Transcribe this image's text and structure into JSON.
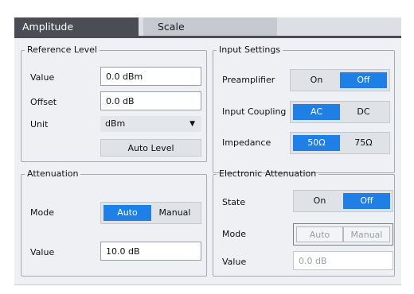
{
  "tabs": [
    {
      "label": "Amplitude",
      "active": true
    },
    {
      "label": "Scale",
      "active": false
    }
  ],
  "reference_level": {
    "legend": "Reference Level",
    "value_label": "Value",
    "value": "0.0 dBm",
    "offset_label": "Offset",
    "offset": "0.0 dB",
    "unit_label": "Unit",
    "unit": "dBm",
    "auto_level": "Auto Level"
  },
  "attenuation": {
    "legend": "Attenuation",
    "mode_label": "Mode",
    "mode_options": [
      "Auto",
      "Manual"
    ],
    "mode_selected": "Auto",
    "value_label": "Value",
    "value": "10.0 dB"
  },
  "input_settings": {
    "legend": "Input Settings",
    "preamplifier_label": "Preamplifier",
    "preamplifier_options": [
      "On",
      "Off"
    ],
    "preamplifier_selected": "Off",
    "coupling_label": "Input Coupling",
    "coupling_options": [
      "AC",
      "DC"
    ],
    "coupling_selected": "AC",
    "impedance_label": "Impedance",
    "impedance_options": [
      "50Ω",
      "75Ω"
    ],
    "impedance_selected": "50Ω"
  },
  "electronic_attenuation": {
    "legend": "Electronic Attenuation",
    "state_label": "State",
    "state_options": [
      "On",
      "Off"
    ],
    "state_selected": "Off",
    "mode_label": "Mode",
    "mode_options": [
      "Auto",
      "Manual"
    ],
    "value_label": "Value",
    "value": "0.0 dB"
  },
  "colors": {
    "accent": "#1e7fe6",
    "tab_active": "#4a4d53",
    "panel": "#eef0f3"
  },
  "icons": {
    "unit_dropdown": "caret-down-icon"
  }
}
